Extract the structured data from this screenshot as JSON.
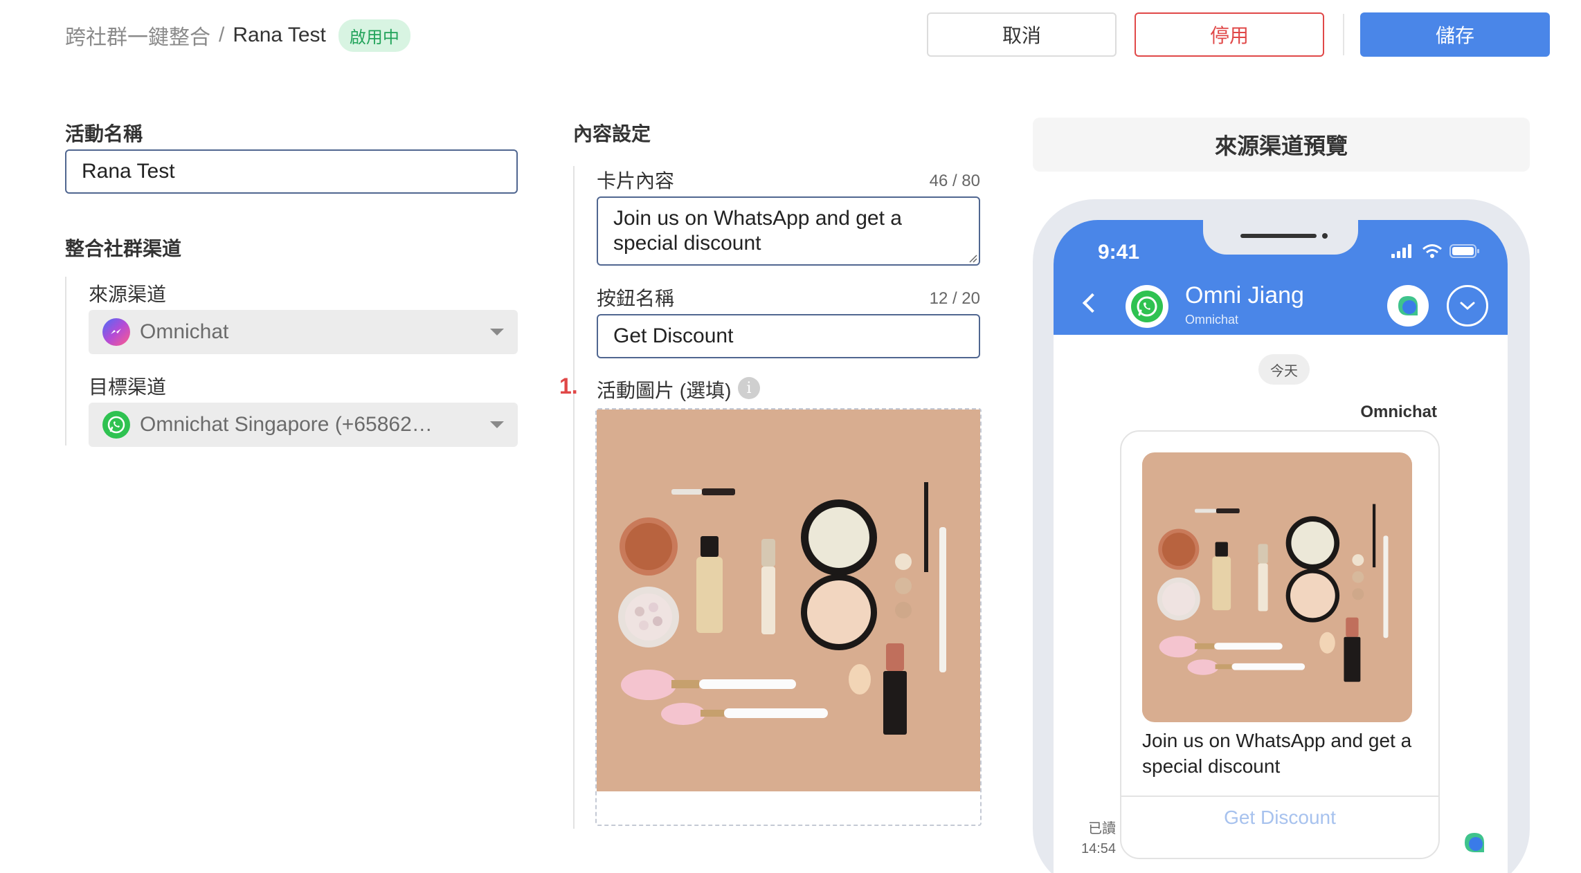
{
  "header": {
    "breadcrumb_root": "跨社群一鍵整合",
    "breadcrumb_separator": "/",
    "breadcrumb_current": "Rana Test",
    "status_badge": "啟用中",
    "cancel_label": "取消",
    "disable_label": "停用",
    "save_label": "儲存"
  },
  "left": {
    "activity_name_label": "活動名稱",
    "activity_name_value": "Rana Test",
    "channels_section_label": "整合社群渠道",
    "source_channel_label": "來源渠道",
    "source_channel_value": "Omnichat",
    "target_channel_label": "目標渠道",
    "target_channel_value": "Omnichat Singapore (+65862…"
  },
  "content": {
    "section_label": "內容設定",
    "card_content_label": "卡片內容",
    "card_content_counter": "46 / 80",
    "card_content_value": "Join us on WhatsApp and get a special discount",
    "button_name_label": "按鈕名稱",
    "button_name_counter": "12 / 20",
    "button_name_value": "Get Discount",
    "step_number": "1.",
    "image_label": "活動圖片 (選填)",
    "info_glyph": "i"
  },
  "preview": {
    "title": "來源渠道預覽",
    "time": "9:41",
    "contact_name": "Omni Jiang",
    "contact_sub": "Omnichat",
    "day_label": "今天",
    "sender_name": "Omnichat",
    "message_text": "Join us on WhatsApp and get a special discount",
    "button_label": "Get Discount",
    "read_label": "已讀",
    "read_time": "14:54"
  },
  "colors": {
    "primary": "#4a86e8",
    "danger": "#e04848",
    "success_badge_bg": "#d8f4e2",
    "success_badge_text": "#21a35a",
    "image_background": "#d8ad90"
  }
}
